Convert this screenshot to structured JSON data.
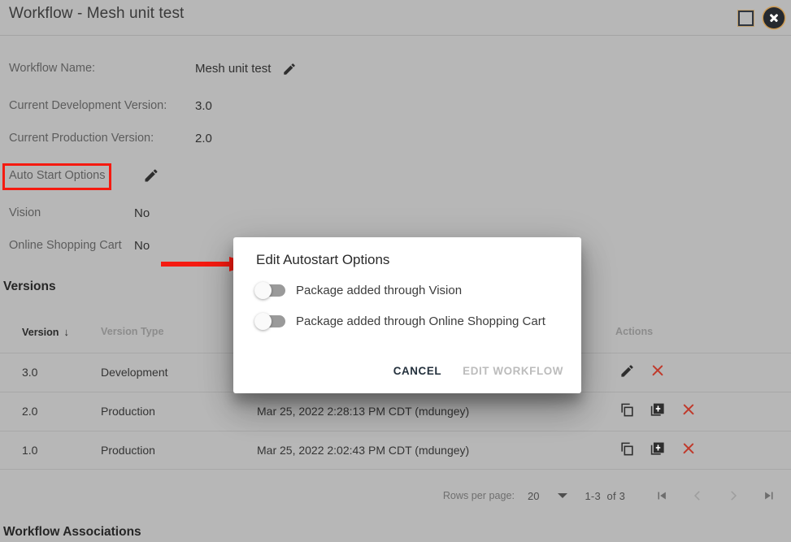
{
  "window": {
    "title": "Workflow - Mesh unit test",
    "maximize_icon": "maximize-square-icon",
    "close_icon": "close-circle-icon"
  },
  "details": {
    "workflow_name_label": "Workflow Name:",
    "workflow_name_value": "Mesh unit test",
    "dev_version_label": "Current Development Version:",
    "dev_version_value": "3.0",
    "prod_version_label": "Current Production Version:",
    "prod_version_value": "2.0",
    "auto_start_label": "Auto Start Options",
    "vision_label": "Vision",
    "vision_value": "No",
    "cart_label": "Online Shopping Cart",
    "cart_value": "No",
    "edit_pencil_icon": "pencil-icon"
  },
  "versions": {
    "section_title": "Versions",
    "columns": [
      "Version",
      "Version Type",
      "",
      "Actions"
    ],
    "sort_column": "Version",
    "sort_direction": "descending",
    "rows": [
      {
        "version": "3.0",
        "type": "Development",
        "date": "",
        "actions": [
          "pencil-icon",
          "delete-x-icon"
        ]
      },
      {
        "version": "2.0",
        "type": "Production",
        "date": "Mar 25, 2022 2:28:13 PM CDT (mdungey)",
        "actions": [
          "copy-icon",
          "library-add-icon",
          "delete-x-icon"
        ]
      },
      {
        "version": "1.0",
        "type": "Production",
        "date": "Mar 25, 2022 2:02:43 PM CDT (mdungey)",
        "actions": [
          "copy-icon",
          "library-add-icon",
          "delete-x-icon"
        ]
      }
    ]
  },
  "paginator": {
    "rows_per_page_label": "Rows per page:",
    "rows_per_page_value": "20",
    "range_label": "1-3",
    "of_label": "of 3",
    "first_icon": "first-page-icon",
    "prev_icon": "prev-page-icon",
    "next_icon": "next-page-icon",
    "last_icon": "last-page-icon"
  },
  "associations": {
    "section_title": "Workflow Associations"
  },
  "modal": {
    "title": "Edit Autostart Options",
    "toggles": [
      {
        "label": "Package added through Vision",
        "checked": false
      },
      {
        "label": "Package added through Online Shopping Cart",
        "checked": false
      }
    ],
    "cancel_label": "CANCEL",
    "submit_label": "EDIT WORKFLOW",
    "submit_disabled": true
  },
  "annotations": {
    "highlight_color": "#f51a10",
    "arrow_color": "#f51a10",
    "highlight_target": "Auto Start Options",
    "arrow_target": "Edit Autostart Options"
  }
}
